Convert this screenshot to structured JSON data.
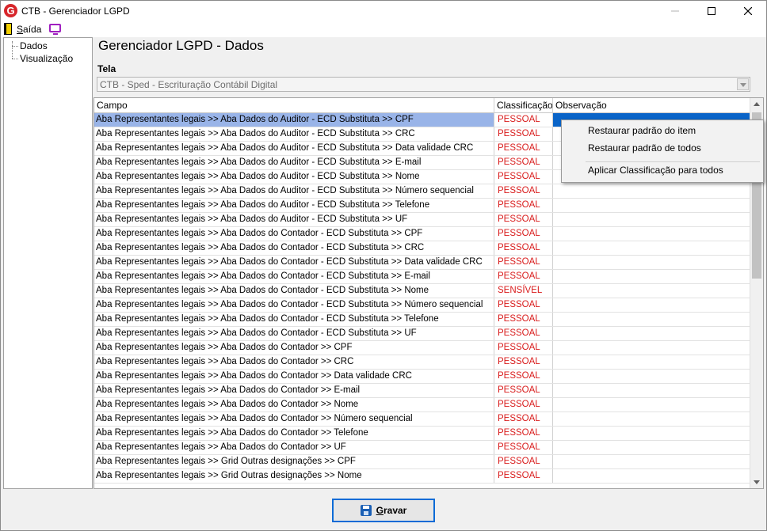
{
  "window": {
    "title": "CTB - Gerenciador LGPD"
  },
  "menu": {
    "exit_first": "S",
    "exit_rest": "aída"
  },
  "tree": {
    "items": [
      "Dados",
      "Visualização"
    ]
  },
  "main": {
    "title": "Gerenciador LGPD - Dados",
    "tela_label": "Tela",
    "tela_value": "CTB - Sped - Escrituração Contábil Digital"
  },
  "grid": {
    "columns": [
      "Campo",
      "Classificação",
      "Observação"
    ],
    "rows": [
      {
        "campo": "Aba Representantes legais >> Aba Dados do Auditor - ECD Substituta >> CPF",
        "classificacao": "PESSOAL",
        "observacao": ""
      },
      {
        "campo": "Aba Representantes legais >> Aba Dados do Auditor - ECD Substituta >> CRC",
        "classificacao": "PESSOAL",
        "observacao": ""
      },
      {
        "campo": "Aba Representantes legais >> Aba Dados do Auditor - ECD Substituta >> Data validade CRC",
        "classificacao": "PESSOAL",
        "observacao": ""
      },
      {
        "campo": "Aba Representantes legais >> Aba Dados do Auditor - ECD Substituta >> E-mail",
        "classificacao": "PESSOAL",
        "observacao": ""
      },
      {
        "campo": "Aba Representantes legais >> Aba Dados do Auditor - ECD Substituta >> Nome",
        "classificacao": "PESSOAL",
        "observacao": ""
      },
      {
        "campo": "Aba Representantes legais >> Aba Dados do Auditor - ECD Substituta >> Número sequencial",
        "classificacao": "PESSOAL",
        "observacao": ""
      },
      {
        "campo": "Aba Representantes legais >> Aba Dados do Auditor - ECD Substituta >> Telefone",
        "classificacao": "PESSOAL",
        "observacao": ""
      },
      {
        "campo": "Aba Representantes legais >> Aba Dados do Auditor - ECD Substituta >> UF",
        "classificacao": "PESSOAL",
        "observacao": ""
      },
      {
        "campo": "Aba Representantes legais >> Aba Dados do Contador - ECD Substituta >> CPF",
        "classificacao": "PESSOAL",
        "observacao": ""
      },
      {
        "campo": "Aba Representantes legais >> Aba Dados do Contador - ECD Substituta >> CRC",
        "classificacao": "PESSOAL",
        "observacao": ""
      },
      {
        "campo": "Aba Representantes legais >> Aba Dados do Contador - ECD Substituta >> Data validade CRC",
        "classificacao": "PESSOAL",
        "observacao": ""
      },
      {
        "campo": "Aba Representantes legais >> Aba Dados do Contador - ECD Substituta >> E-mail",
        "classificacao": "PESSOAL",
        "observacao": ""
      },
      {
        "campo": "Aba Representantes legais >> Aba Dados do Contador - ECD Substituta >> Nome",
        "classificacao": "SENSÍVEL",
        "observacao": ""
      },
      {
        "campo": "Aba Representantes legais >> Aba Dados do Contador - ECD Substituta >> Número sequencial",
        "classificacao": "PESSOAL",
        "observacao": ""
      },
      {
        "campo": "Aba Representantes legais >> Aba Dados do Contador - ECD Substituta >> Telefone",
        "classificacao": "PESSOAL",
        "observacao": ""
      },
      {
        "campo": "Aba Representantes legais >> Aba Dados do Contador - ECD Substituta >> UF",
        "classificacao": "PESSOAL",
        "observacao": ""
      },
      {
        "campo": "Aba Representantes legais >> Aba Dados do Contador >> CPF",
        "classificacao": "PESSOAL",
        "observacao": ""
      },
      {
        "campo": "Aba Representantes legais >> Aba Dados do Contador >> CRC",
        "classificacao": "PESSOAL",
        "observacao": ""
      },
      {
        "campo": "Aba Representantes legais >> Aba Dados do Contador >> Data validade CRC",
        "classificacao": "PESSOAL",
        "observacao": ""
      },
      {
        "campo": "Aba Representantes legais >> Aba Dados do Contador >> E-mail",
        "classificacao": "PESSOAL",
        "observacao": ""
      },
      {
        "campo": "Aba Representantes legais >> Aba Dados do Contador >> Nome",
        "classificacao": "PESSOAL",
        "observacao": ""
      },
      {
        "campo": "Aba Representantes legais >> Aba Dados do Contador >> Número sequencial",
        "classificacao": "PESSOAL",
        "observacao": ""
      },
      {
        "campo": "Aba Representantes legais >> Aba Dados do Contador >> Telefone",
        "classificacao": "PESSOAL",
        "observacao": ""
      },
      {
        "campo": "Aba Representantes legais >> Aba Dados do Contador >> UF",
        "classificacao": "PESSOAL",
        "observacao": ""
      },
      {
        "campo": "Aba Representantes legais >> Grid  Outras designações >> CPF",
        "classificacao": "PESSOAL",
        "observacao": ""
      },
      {
        "campo": "Aba Representantes legais >> Grid  Outras designações >> Nome",
        "classificacao": "PESSOAL",
        "observacao": ""
      }
    ]
  },
  "context_menu": {
    "items": [
      "Restaurar padrão do item",
      "Restaurar padrão de todos",
      "Aplicar Classificação para todos"
    ]
  },
  "buttons": {
    "save_first": "G",
    "save_rest": "ravar"
  },
  "colors": {
    "classification_text": "#d91c1c",
    "selected_row": "#99b4e8",
    "selected_cell": "#0a64c8",
    "app_icon": "#d7262b"
  },
  "icons": {
    "app": "app-logo-icon",
    "exit": "exit-door-icon",
    "view": "monitor-icon",
    "save": "floppy-disk-icon"
  }
}
